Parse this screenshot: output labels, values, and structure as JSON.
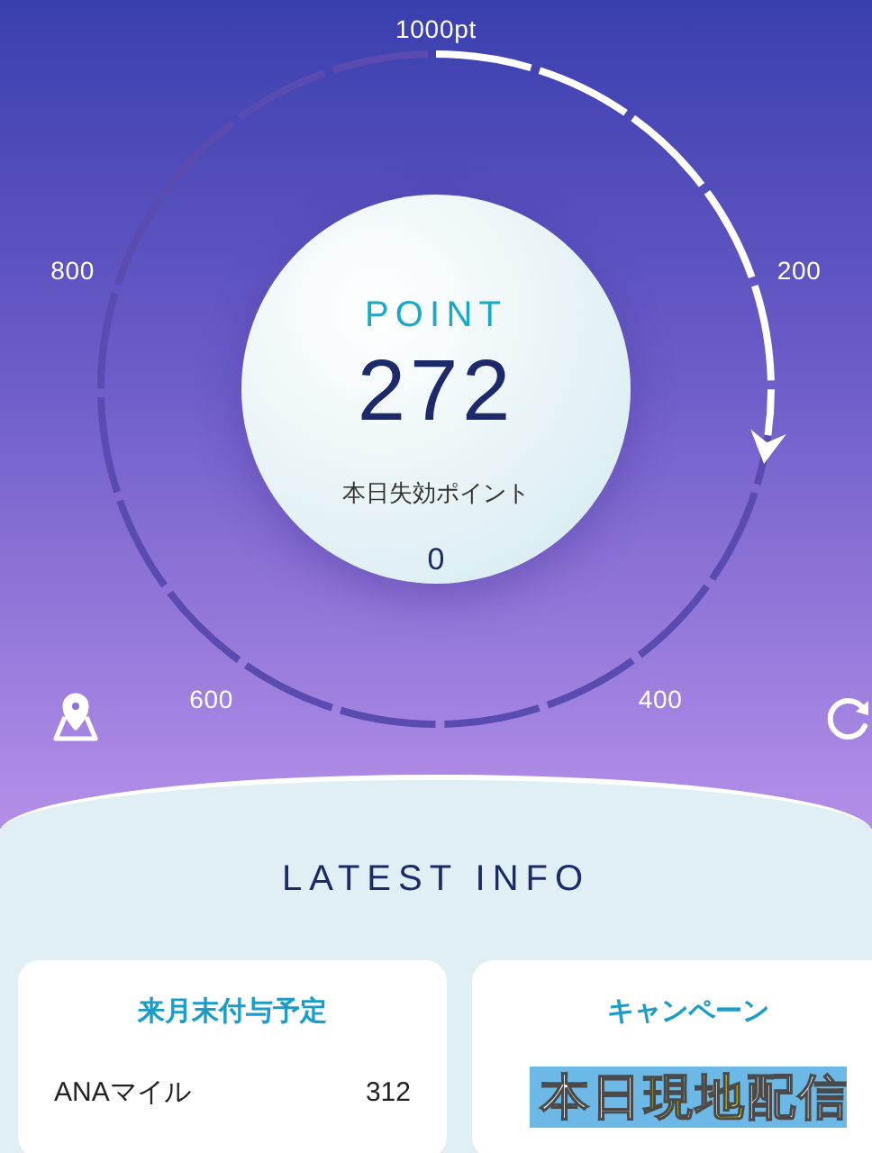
{
  "gauge": {
    "ticks": [
      "1000pt",
      "200",
      "400",
      "600",
      "800"
    ],
    "label": "POINT",
    "value": "272",
    "expiring_label": "本日失効ポイント",
    "expiring_value": "0"
  },
  "latest_info": {
    "title": "LATEST INFO",
    "cards": [
      {
        "kind": "list",
        "title": "来月末付与予定",
        "rows": [
          {
            "name": "ANAマイル",
            "value": "312"
          }
        ]
      },
      {
        "kind": "banner",
        "title": "キャンペーン",
        "banner": [
          {
            "text": "本日",
            "highlight": false
          },
          {
            "text": "現地",
            "highlight": true
          },
          {
            "text": "配信",
            "highlight": false
          }
        ]
      }
    ]
  }
}
